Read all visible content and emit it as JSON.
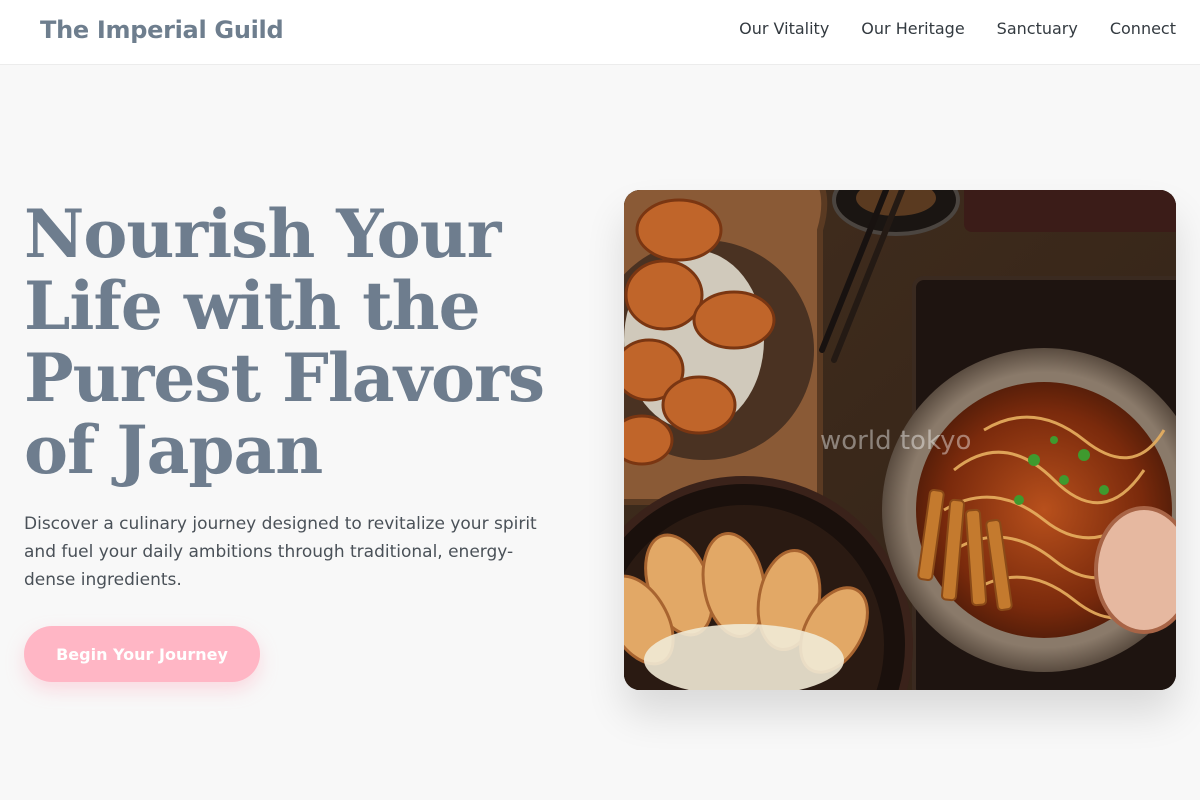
{
  "header": {
    "brand": "The Imperial Guild",
    "nav": [
      "Our Vitality",
      "Our Heritage",
      "Sanctuary",
      "Connect"
    ]
  },
  "hero": {
    "title": "Nourish Your Life with the Purest Flavors of Japan",
    "subtitle": "Discover a culinary journey designed to revitalize your spirit and fuel your daily ambitions through traditional, energy-dense ingredients.",
    "cta_label": "Begin Your Journey",
    "image": {
      "watermark": "world tokyo",
      "subject": "ramen-karaage-gyoza-photo"
    }
  },
  "colors": {
    "brand": "#6e7e8e",
    "title": "#6e7d8e",
    "cta": "#ffb6c5",
    "background": "#f8f8f8"
  }
}
